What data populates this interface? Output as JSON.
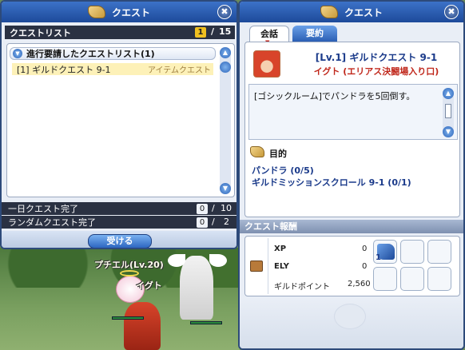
{
  "left_window": {
    "title": "クエスト",
    "header": {
      "label": "クエストリスト",
      "page_current": "1",
      "page_sep": "/",
      "page_total": "15"
    },
    "group": {
      "label": "進行要請したクエストリスト(1)"
    },
    "quests": [
      {
        "name": "[1] ギルドクエスト 9-1",
        "type": "アイテムクエスト"
      }
    ],
    "daily": {
      "label": "一日クエスト完了",
      "done": "0",
      "sep": "/",
      "total": "10"
    },
    "random": {
      "label": "ランダムクエスト完了",
      "done": "0",
      "sep": "/",
      "total": "2"
    },
    "accept_label": "受ける"
  },
  "scene": {
    "npc_label": "プチエル(Lv.20)",
    "player_label": "イグト"
  },
  "right_window": {
    "title": "クエスト",
    "tabs": [
      {
        "label": "会話"
      },
      {
        "label": "要約"
      }
    ],
    "quest_title": "[Lv.1] ギルドクエスト 9-1",
    "quest_npc": "イグト (エリアス決闘場入り口)",
    "description": "[ゴシックルーム]でパンドラを5回倒す。",
    "objective_label": "目的",
    "objectives": [
      "パンドラ (0/5)",
      "ギルドミッションスクロール 9-1 (0/1)"
    ],
    "reward_header": "クエスト報酬",
    "rewards": [
      {
        "label": "XP",
        "value": "0"
      },
      {
        "label": "ELY",
        "value": "0"
      },
      {
        "label": "ギルドポイント",
        "value": "2,560"
      }
    ],
    "item_count": "1"
  },
  "colors": {
    "title_blue": "#1d4a9a",
    "quest_name": "#1a3a8a",
    "npc_red": "#c0281c",
    "dark_bar": "#2a3142"
  }
}
